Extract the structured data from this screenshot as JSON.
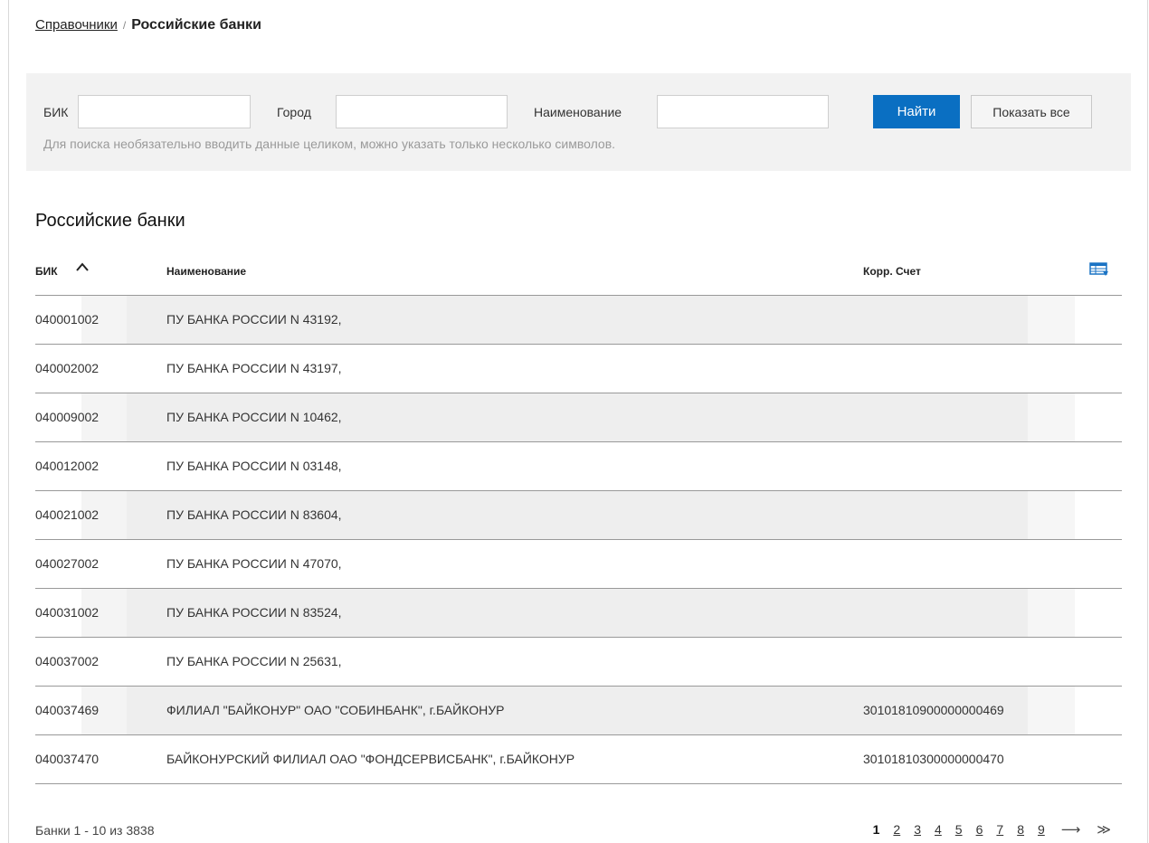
{
  "breadcrumb": {
    "parent": "Справочники",
    "separator": "/",
    "current": "Российские банки"
  },
  "filters": {
    "bik_label": "БИК",
    "bik_value": "",
    "city_label": "Город",
    "city_value": "",
    "name_label": "Наименование",
    "name_value": "",
    "find_button": "Найти",
    "show_all_button": "Показать все",
    "hint": "Для поиска необязательно вводить данные целиком, можно указать только несколько символов."
  },
  "table": {
    "title": "Российские банки",
    "columns": {
      "bik": "БИК",
      "name": "Наименование",
      "account": "Корр. Счет"
    },
    "sort": {
      "column": "bik",
      "direction": "asc",
      "icon": "chevron-up-icon"
    },
    "column_settings_icon": "table-columns-icon",
    "rows": [
      {
        "bik": "040001002",
        "name": "ПУ БАНКА РОССИИ N 43192,",
        "account": ""
      },
      {
        "bik": "040002002",
        "name": "ПУ БАНКА РОССИИ N 43197,",
        "account": ""
      },
      {
        "bik": "040009002",
        "name": "ПУ БАНКА РОССИИ N 10462,",
        "account": ""
      },
      {
        "bik": "040012002",
        "name": "ПУ БАНКА РОССИИ N 03148,",
        "account": ""
      },
      {
        "bik": "040021002",
        "name": "ПУ БАНКА РОССИИ N 83604,",
        "account": ""
      },
      {
        "bik": "040027002",
        "name": "ПУ БАНКА РОССИИ N 47070,",
        "account": ""
      },
      {
        "bik": "040031002",
        "name": "ПУ БАНКА РОССИИ N 83524,",
        "account": ""
      },
      {
        "bik": "040037002",
        "name": "ПУ БАНКА РОССИИ N 25631,",
        "account": ""
      },
      {
        "bik": "040037469",
        "name": "ФИЛИАЛ \"БАЙКОНУР\" ОАО \"СОБИНБАНК\", г.БАЙКОНУР",
        "account": "30101810900000000469"
      },
      {
        "bik": "040037470",
        "name": "БАЙКОНУРСКИЙ ФИЛИАЛ ОАО \"ФОНДСЕРВИСБАНК\", г.БАЙКОНУР",
        "account": "30101810300000000470"
      }
    ]
  },
  "footer": {
    "count": "Банки 1 - 10 из 3838",
    "pages": [
      "1",
      "2",
      "3",
      "4",
      "5",
      "6",
      "7",
      "8",
      "9"
    ],
    "current_page": "1",
    "next_label": "⟶",
    "last_label": "≫"
  },
  "colors": {
    "accent": "#0a6fc2",
    "panel_bg": "#f2f2f2",
    "row_alt_bg": "#eeeeee",
    "border": "#999999"
  }
}
